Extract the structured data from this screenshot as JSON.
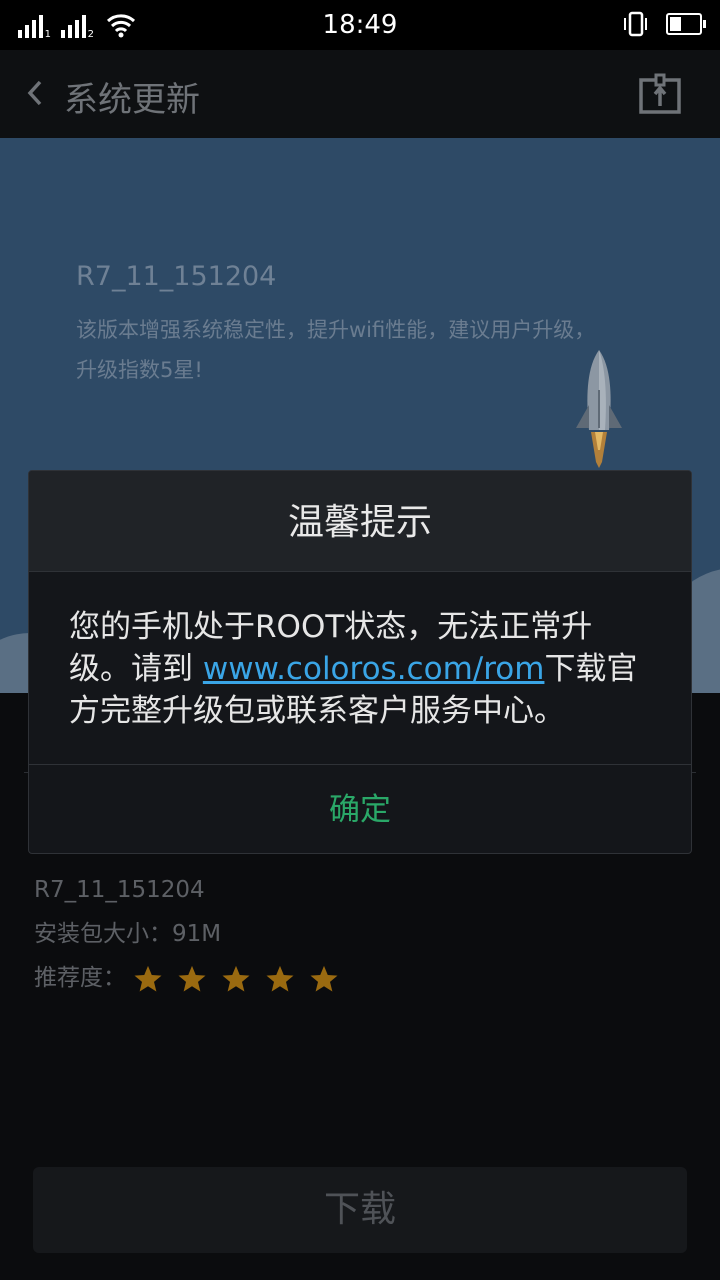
{
  "status_bar": {
    "time": "18:49",
    "sim1_label": "1",
    "sim2_label": "2",
    "icons": [
      "signal-icon",
      "signal-icon",
      "wifi-icon",
      "vibrate-icon",
      "battery-icon"
    ]
  },
  "header": {
    "title": "系统更新",
    "back_icon": "chevron-left-icon",
    "action_icon": "tools-icon"
  },
  "hero": {
    "version": "R7_11_151204",
    "description": "该版本增强系统稳定性，提升wifi性能，建议用户升级，升级指数5星!"
  },
  "details": {
    "version": "R7_11_151204",
    "package_size": "安装包大小：91M",
    "rating_label": "推荐度：",
    "rating_stars": 5,
    "rating_max": 5
  },
  "download_button": "下载",
  "dialog": {
    "title": "温馨提示",
    "message_prefix": "您的手机处于ROOT状态，无法正常升级。请到 ",
    "message_link": "www.coloros.com/rom",
    "message_suffix": "下载官方完整升级包或联系客户服务中心。",
    "confirm_button": "确定"
  },
  "colors": {
    "hero_bg": "#2e4a66",
    "link": "#3aa5e6",
    "confirm": "#2aa868",
    "star": "#9a6a10"
  }
}
